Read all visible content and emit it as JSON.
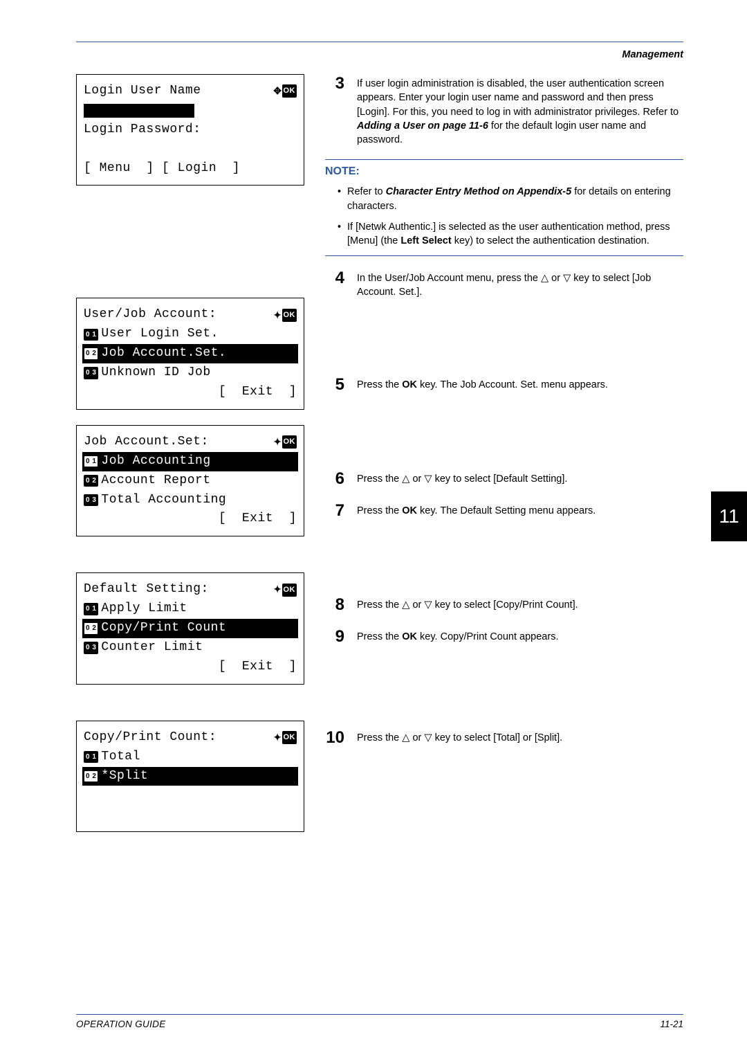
{
  "header": {
    "section": "Management"
  },
  "tab": {
    "number": "11"
  },
  "footer": {
    "left": "OPERATION GUIDE",
    "right": "11-21"
  },
  "lcd1": {
    "title": "Login User Name",
    "ok": "OK",
    "password_label": "Login Password:",
    "left_soft": "Menu",
    "right_soft": "Login"
  },
  "lcd2": {
    "title": "User/Job Account:",
    "ok": "OK",
    "item1": "User Login Set.",
    "item2": "Job Account.Set.",
    "item3": "Unknown ID Job",
    "right_soft": "Exit"
  },
  "lcd3": {
    "title": "Job Account.Set:",
    "ok": "OK",
    "item1": "Job Accounting",
    "item2": "Account Report",
    "item3": "Total Accounting",
    "right_soft": "Exit"
  },
  "lcd4": {
    "title": "Default Setting:",
    "ok": "OK",
    "item1": "Apply Limit",
    "item2": "Copy/Print Count",
    "item3": "Counter Limit",
    "right_soft": "Exit"
  },
  "lcd5": {
    "title": "Copy/Print Count:",
    "ok": "OK",
    "item1": "Total",
    "item2": "*Split"
  },
  "steps": {
    "3": {
      "text_a": "If user login administration is disabled, the user authentication screen appears. Enter your login user name and password and then press [Login]. For this, you need to log in with administrator privileges. Refer to ",
      "ref": "Adding a User on page 11-6",
      "text_b": " for the default login user name and password."
    },
    "4": {
      "text_a": "In the User/Job Account menu, press the ",
      "text_b": " or ",
      "text_c": " key to select [Job Account. Set.]."
    },
    "5": {
      "text_a": "Press the ",
      "ok": "OK",
      "text_b": " key. The Job Account. Set. menu appears."
    },
    "6": {
      "text_a": "Press the ",
      "text_b": " or ",
      "text_c": " key to select [Default Setting]."
    },
    "7": {
      "text_a": "Press the ",
      "ok": "OK",
      "text_b": " key. The Default Setting menu appears."
    },
    "8": {
      "text_a": "Press the ",
      "text_b": " or ",
      "text_c": " key to select [Copy/Print Count]."
    },
    "9": {
      "text_a": "Press the ",
      "ok": "OK",
      "text_b": " key. Copy/Print Count appears."
    },
    "10": {
      "text_a": "Press the ",
      "text_b": " or ",
      "text_c": " key to select [Total] or [Split]."
    }
  },
  "step_numbers": {
    "3": "3",
    "4": "4",
    "5": "5",
    "6": "6",
    "7": "7",
    "8": "8",
    "9": "9",
    "10": "10"
  },
  "note": {
    "title": "NOTE:",
    "item1_a": "Refer to ",
    "item1_ref": "Character Entry Method on Appendix-5",
    "item1_b": " for details on entering characters.",
    "item2_a": "If [Netwk Authentic.] is selected as the user authentication method, press [Menu] (the ",
    "item2_b": "Left Select",
    "item2_c": " key) to select the authentication destination."
  },
  "badges": {
    "b01": "0 1",
    "b02": "0 2",
    "b03": "0 3"
  }
}
